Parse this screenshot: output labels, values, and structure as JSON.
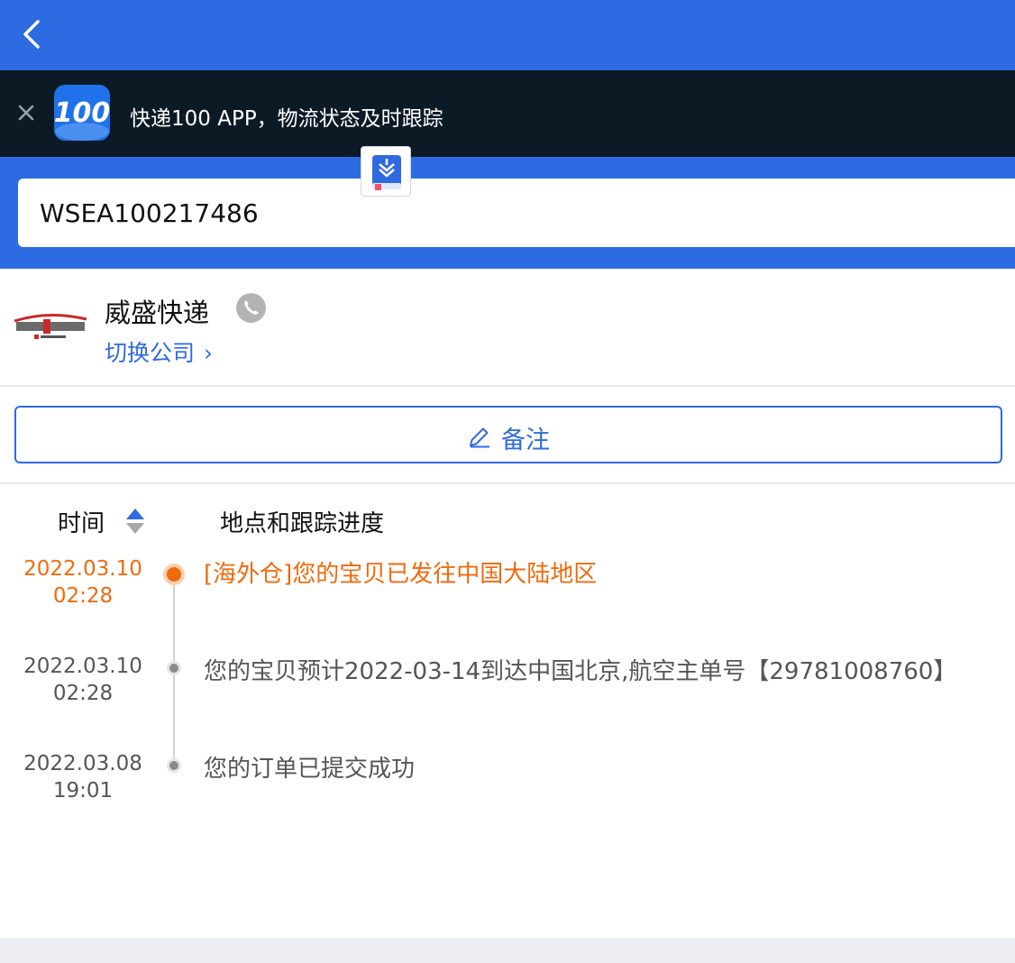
{
  "header": {
    "back_icon": "chevron-left-icon"
  },
  "banner": {
    "close_icon": "close-icon",
    "logo_text": "100",
    "text": "快递100 APP，物流状态及时跟踪"
  },
  "search": {
    "value": "WSEA100217486",
    "floating_icon": "book-icon"
  },
  "company": {
    "name": "威盛快递",
    "phone_icon": "phone-icon",
    "switch_label": "切换公司",
    "switch_chevron": "›"
  },
  "note": {
    "label": "备注",
    "icon": "pencil-icon"
  },
  "tracking": {
    "col_time": "时间",
    "col_location": "地点和跟踪进度",
    "sort_icon": "sort-icon",
    "items": [
      {
        "date": "2022.03.10",
        "time": "02:28",
        "text": "[海外仓]您的宝贝已发往中国大陆地区",
        "active": true
      },
      {
        "date": "2022.03.10",
        "time": "02:28",
        "text": "您的宝贝预计2022-03-14到达中国北京,航空主单号【29781008760】",
        "active": false
      },
      {
        "date": "2022.03.08",
        "time": "19:01",
        "text": "您的订单已提交成功",
        "active": false
      }
    ]
  },
  "colors": {
    "primary": "#2c6be2",
    "banner_bg": "#0c1a26",
    "accent_orange": "#f06a0c",
    "link_blue": "#2f6ae0"
  }
}
